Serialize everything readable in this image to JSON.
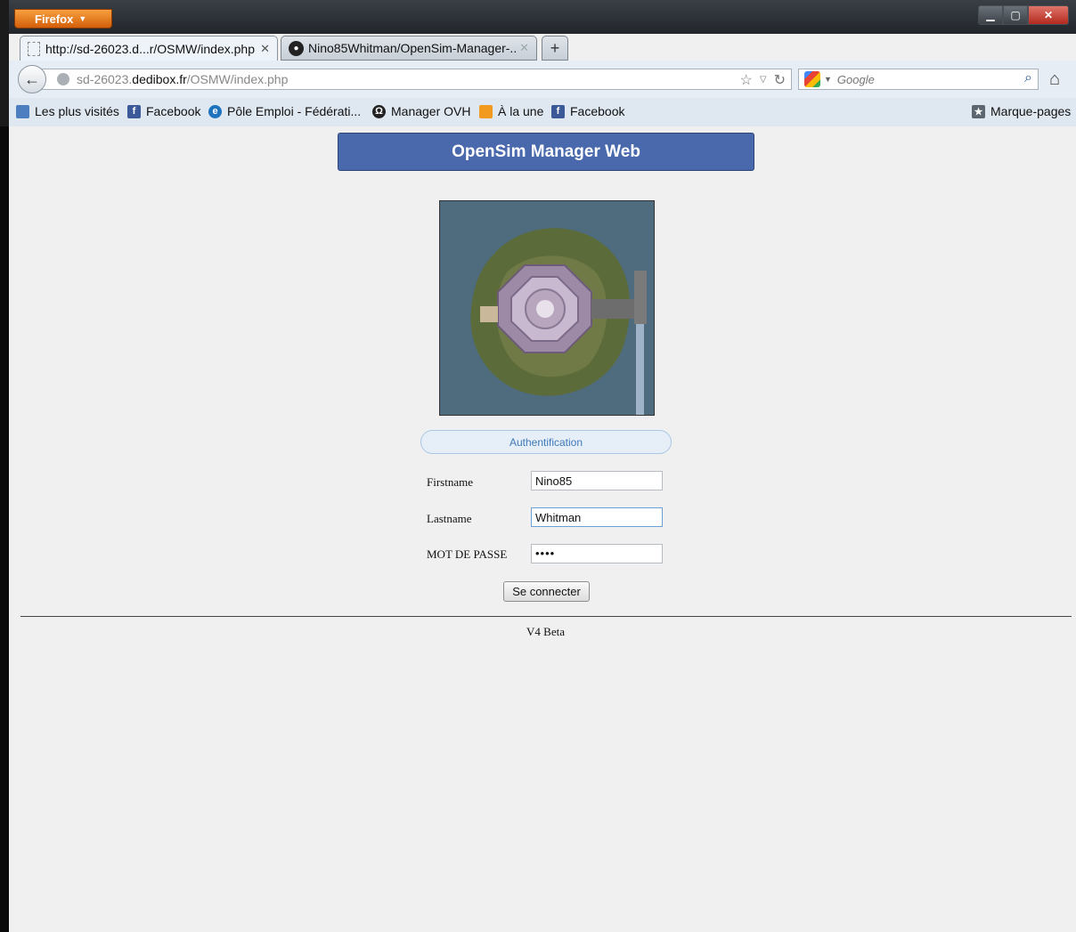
{
  "browser": {
    "app_button": "Firefox",
    "tabs": [
      {
        "label": "http://sd-26023.d...r/OSMW/index.php"
      },
      {
        "label": "Nino85Whitman/OpenSim-Manager-..."
      }
    ],
    "new_tab": "+",
    "url": {
      "prefix": "sd-26023.",
      "domain": "dedibox.fr",
      "path": "/OSMW/index.php"
    },
    "search_placeholder": "Google",
    "bookmarks": [
      "Les plus visités",
      "Facebook",
      "Pôle Emploi - Fédérati...",
      "Manager OVH",
      "À la une",
      "Facebook"
    ],
    "bookmarks_menu": "Marque-pages"
  },
  "page": {
    "title": "OpenSim Manager Web",
    "auth_label": "Authentification",
    "form": {
      "firstname_label": "Firstname",
      "firstname_value": "Nino85",
      "lastname_label": "Lastname",
      "lastname_value": "Whitman",
      "password_label": "MOT DE PASSE",
      "password_value": "••••"
    },
    "submit_label": "Se connecter",
    "footer": "V4 Beta"
  }
}
